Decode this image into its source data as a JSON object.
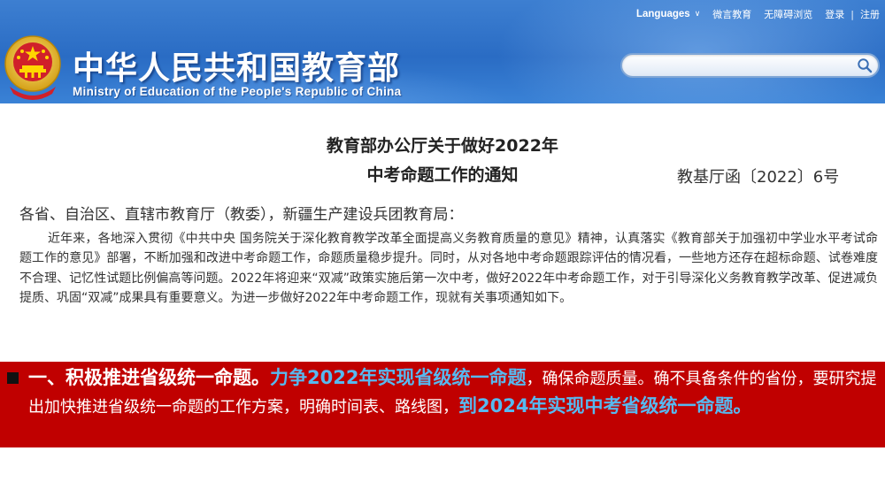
{
  "header": {
    "title_cn": "中华人民共和国教育部",
    "title_en": "Ministry of Education of the People's Republic of China",
    "emblem_icon": "national-emblem-icon",
    "colors": {
      "header_blue": "#2a6cc4",
      "banner_red": "#c00000",
      "highlight_blue": "#57b9f0"
    }
  },
  "topnav": {
    "languages": "Languages",
    "chevron": "∨",
    "weibo": "微言教育",
    "accessibility": "无障碍浏览",
    "login": "登录",
    "separator": "|",
    "register": "注册"
  },
  "search": {
    "placeholder": "",
    "value": "",
    "icon": "search-icon"
  },
  "document": {
    "title_line1": "教育部办公厅关于做好2022年",
    "title_line2": "中考命题工作的通知",
    "doc_number": "教基厅函〔2022〕6号",
    "salutation": "各省、自治区、直辖市教育厅（教委），新疆生产建设兵团教育局：",
    "body": "近年来，各地深入贯彻《中共中央 国务院关于深化教育教学改革全面提高义务教育质量的意见》精神，认真落实《教育部关于加强初中学业水平考试命题工作的意见》部署，不断加强和改进中考命题工作，命题质量稳步提升。同时，从对各地中考命题跟踪评估的情况看，一些地方还存在超标命题、试卷难度不合理、记忆性试题比例偏高等问题。2022年将迎来“双减”政策实施后第一次中考，做好2022年中考命题工作，对于引导深化义务教育教学改革、促进减负提质、巩固“双减”成果具有重要意义。为进一步做好2022年中考命题工作，现就有关事项通知如下。"
  },
  "banner": {
    "bullet": "■",
    "heading": "一、积极推进省级统一命题。",
    "highlight1": "力争2022年实现省级统一命题",
    "plain_text": "，确保命题质量。确不具备条件的省份，要研究提出加快推进省级统一命题的工作方案，明确时间表、路线图，",
    "highlight2": "到2024年实现中考省级统一命题。"
  }
}
